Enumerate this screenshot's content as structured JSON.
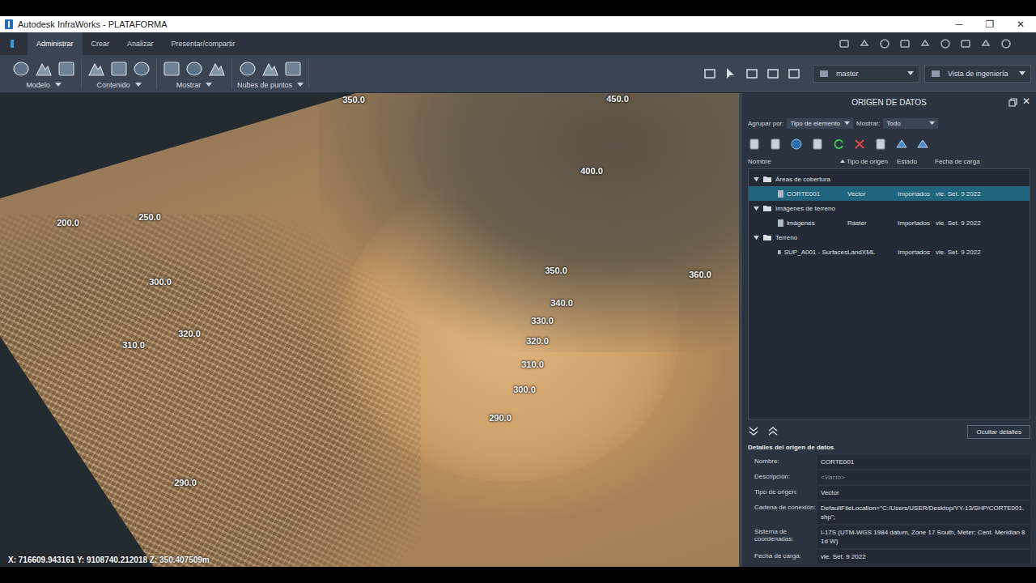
{
  "window": {
    "title": "Autodesk InfraWorks - PLATAFORMA",
    "controls": [
      "─",
      "❐",
      "✕"
    ]
  },
  "ribbon": {
    "tabs": [
      {
        "label": "Administrar",
        "selected": true
      },
      {
        "label": "Crear",
        "selected": false
      },
      {
        "label": "Analizar",
        "selected": false
      },
      {
        "label": "Presentar/compartir",
        "selected": false
      }
    ],
    "groups": [
      {
        "label": "Modelo"
      },
      {
        "label": "Contenido"
      },
      {
        "label": "Mostrar"
      },
      {
        "label": "Nubes de puntos"
      }
    ],
    "dropdowns": [
      {
        "value": "master"
      },
      {
        "value": "Vista de ingeniería"
      }
    ]
  },
  "viewport": {
    "contour_labels": [
      "350.0",
      "450.0",
      "400.0",
      "200.0",
      "250.0",
      "300.0",
      "350.0",
      "360.0",
      "340.0",
      "330.0",
      "320.0",
      "320.0",
      "310.0",
      "310.0",
      "300.0",
      "290.0",
      "290.0"
    ],
    "coordinates": "X: 716609.943161 Y: 9108740.212018 Z: 350.407509m"
  },
  "panel": {
    "title": "ORIGEN DE DATOS",
    "close": "✕",
    "group_by": {
      "label": "Agrupar por:",
      "value": "Tipo de elemento"
    },
    "show": {
      "label": "Mostrar:",
      "value": "Todo"
    },
    "columns": [
      {
        "label": "Nombre",
        "sorted": false
      },
      {
        "label": "Tipo de origen",
        "sorted": true
      },
      {
        "label": "Estado",
        "sorted": false
      },
      {
        "label": "Fecha de carga",
        "sorted": false
      }
    ],
    "tree": [
      {
        "label": "Áreas de cobertura",
        "expanded": true,
        "items": [
          {
            "name": "CORTE001",
            "type": "Vector",
            "status": "Importados",
            "date": "vie. Set. 9 2022",
            "selected": true
          }
        ]
      },
      {
        "label": "Imágenes de terreno",
        "expanded": true,
        "items": [
          {
            "name": "imágenes",
            "type": "Ráster",
            "status": "Importados",
            "date": "vie. Set. 9 2022",
            "selected": false
          }
        ]
      },
      {
        "label": "Terreno",
        "expanded": true,
        "items": [
          {
            "name": "SUP_A001 - Surfaces",
            "type": "LandXML",
            "status": "Importados",
            "date": "vie. Set. 9 2022",
            "selected": false
          }
        ]
      }
    ],
    "hide_details": "Ocultar detalles",
    "details": {
      "title": "Detalles del origen de datos",
      "fields": [
        {
          "label": "Nombre:",
          "value": "CORTE001",
          "placeholder": false
        },
        {
          "label": "Descripción:",
          "value": "<Vacío>",
          "placeholder": true
        },
        {
          "label": "Tipo de origen:",
          "value": "Vector",
          "placeholder": false
        },
        {
          "label": "Cadena de conexión:",
          "value": "DefaultFileLocation=\"C:/Users/USER/Desktop/YY-13/SHP/CORTE001.shp\";",
          "placeholder": false
        },
        {
          "label": "Sistema de coordenadas:",
          "value": "I-17S (UTM-WGS 1984 datum, Zone 17 South, Meter; Cent. Meridian 81d W)",
          "placeholder": false
        },
        {
          "label": "Fecha de carga:",
          "value": "vie. Set. 9 2022",
          "placeholder": false
        }
      ]
    }
  }
}
